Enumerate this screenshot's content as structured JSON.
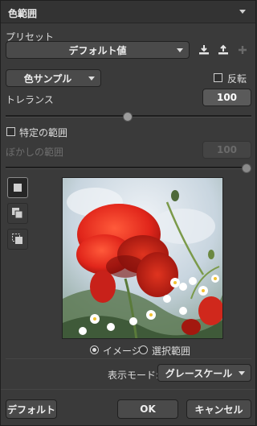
{
  "panel": {
    "title": "色範囲"
  },
  "preset": {
    "label": "プリセット",
    "value": "デフォルト値",
    "icons": [
      "download-icon",
      "upload-icon",
      "add-icon"
    ]
  },
  "sampler": {
    "value": "色サンプル",
    "invert_label": "反転"
  },
  "tolerance": {
    "label": "トレランス",
    "value": "100",
    "slider_fraction": 0.5
  },
  "specific_range": {
    "label": "特定の範囲"
  },
  "blur_range": {
    "label": "ぼかしの範囲",
    "value": "100",
    "slider_fraction": 1.0
  },
  "view_options": {
    "image_label": "イメージ",
    "selection_label": "選択範囲",
    "selected": "image"
  },
  "display_mode": {
    "label": "表示モード:",
    "value": "グレースケール"
  },
  "footer": {
    "default_label": "デフォルト",
    "ok_label": "OK",
    "cancel_label": "キャンセル"
  }
}
